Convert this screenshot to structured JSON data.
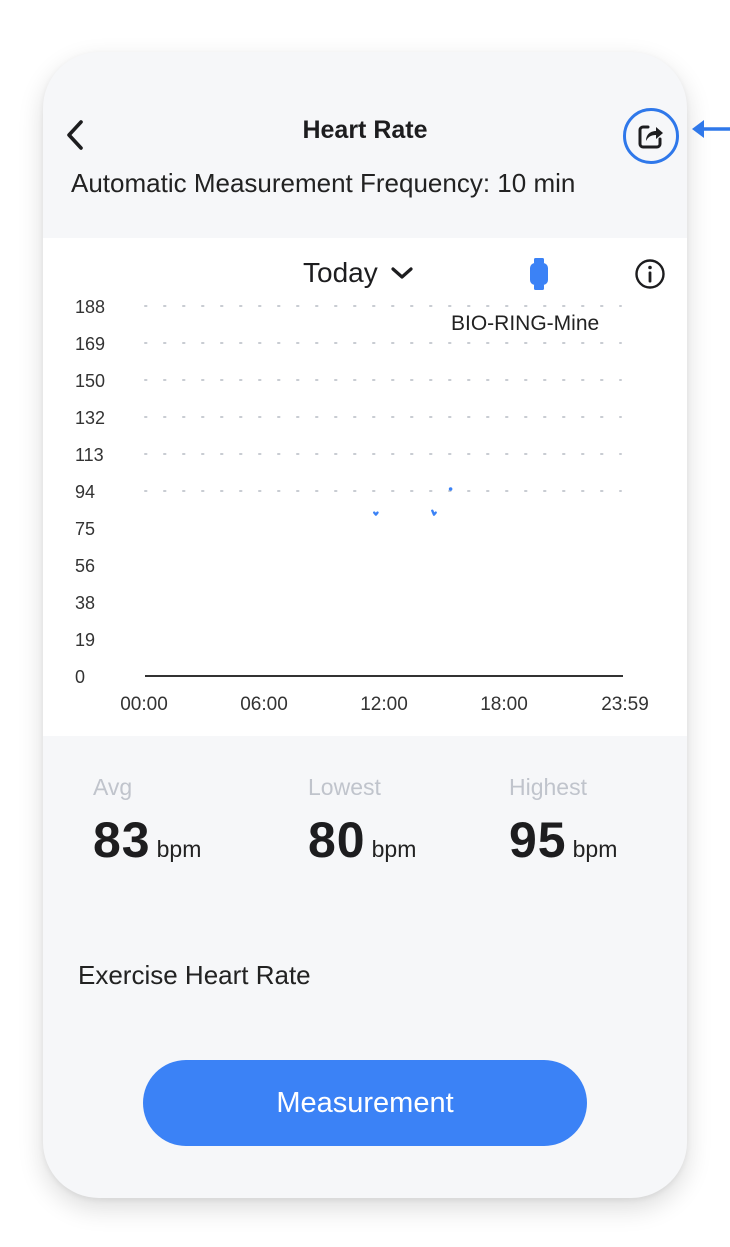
{
  "header": {
    "title": "Heart Rate",
    "subtitle": "Automatic Measurement Frequency: 10 min",
    "back_icon": "chevron-left-icon",
    "share_icon": "share-icon"
  },
  "chart": {
    "date_selector": "Today",
    "device_name": "BIO-RING-Mine",
    "device_icon": "watch-icon",
    "info_icon": "info-icon"
  },
  "chart_data": {
    "type": "line",
    "y_ticks": [
      "188",
      "169",
      "150",
      "132",
      "113",
      "94",
      "75",
      "56",
      "38",
      "19",
      "0"
    ],
    "ylim": [
      0,
      188
    ],
    "x_ticks": [
      "00:00",
      "06:00",
      "12:00",
      "18:00",
      "23:59"
    ],
    "xlim_minutes": [
      0,
      1439
    ],
    "points": [
      {
        "t": 690,
        "bpm": 83
      },
      {
        "t": 695,
        "bpm": 82
      },
      {
        "t": 700,
        "bpm": 83
      },
      {
        "t": 865,
        "bpm": 84
      },
      {
        "t": 870,
        "bpm": 82
      },
      {
        "t": 875,
        "bpm": 83
      },
      {
        "t": 920,
        "bpm": 95
      }
    ],
    "grid": "dotted"
  },
  "stats": {
    "avg": {
      "label": "Avg",
      "value": "83",
      "unit": "bpm"
    },
    "lowest": {
      "label": "Lowest",
      "value": "80",
      "unit": "bpm"
    },
    "highest": {
      "label": "Highest",
      "value": "95",
      "unit": "bpm"
    }
  },
  "exercise": {
    "label": "Exercise Heart Rate"
  },
  "actions": {
    "measure_label": "Measurement"
  },
  "colors": {
    "accent": "#3b82f6",
    "highlight_ring": "#2f78ea",
    "text": "#1d1d1f",
    "muted": "#c0c4cc"
  }
}
